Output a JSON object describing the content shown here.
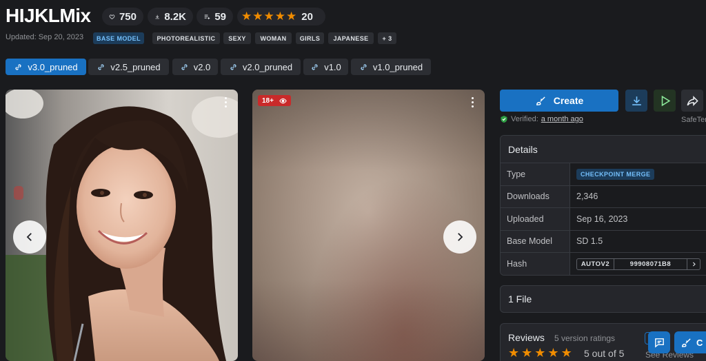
{
  "model": {
    "title": "HIJKLMix",
    "updated": "Updated: Sep 20, 2023"
  },
  "stats": {
    "likes": "750",
    "downloads": "8.2K",
    "collections": "59",
    "rating_count": "20",
    "rating_stars": 5
  },
  "tags": {
    "base": "BASE MODEL",
    "items": [
      "PHOTOREALISTIC",
      "SEXY",
      "WOMAN",
      "GIRLS",
      "JAPANESE"
    ],
    "more": "+ 3"
  },
  "versions": [
    "v3.0_pruned",
    "v2.5_pruned",
    "v2.0",
    "v2.0_pruned",
    "v1.0",
    "v1.0_pruned"
  ],
  "active_version": "v3.0_pruned",
  "gallery": {
    "nsfw_badge": "18+"
  },
  "actions": {
    "create_label": "Create",
    "verified_label": "Verified:",
    "verified_time": "a month ago",
    "safetensor_label": "SafeTensor"
  },
  "details": {
    "title": "Details",
    "rows": {
      "type_label": "Type",
      "type_value": "CHECKPOINT MERGE",
      "downloads_label": "Downloads",
      "downloads_value": "2,346",
      "uploaded_label": "Uploaded",
      "uploaded_value": "Sep 16, 2023",
      "base_model_label": "Base Model",
      "base_model_value": "SD 1.5",
      "hash_label": "Hash",
      "hash_algo": "AUTOV2",
      "hash_value": "99908071B8"
    }
  },
  "files": {
    "label": "1 File"
  },
  "reviews": {
    "title": "Reviews",
    "count": "5 version ratings",
    "score": "5 out of 5",
    "see_link": "See Reviews",
    "stars": 5
  },
  "floating": {
    "create_label": "C"
  },
  "colors": {
    "background": "#1a1b1e",
    "accent": "#1971c2",
    "star": "#f08c00",
    "nsfw": "#c92a2a"
  }
}
